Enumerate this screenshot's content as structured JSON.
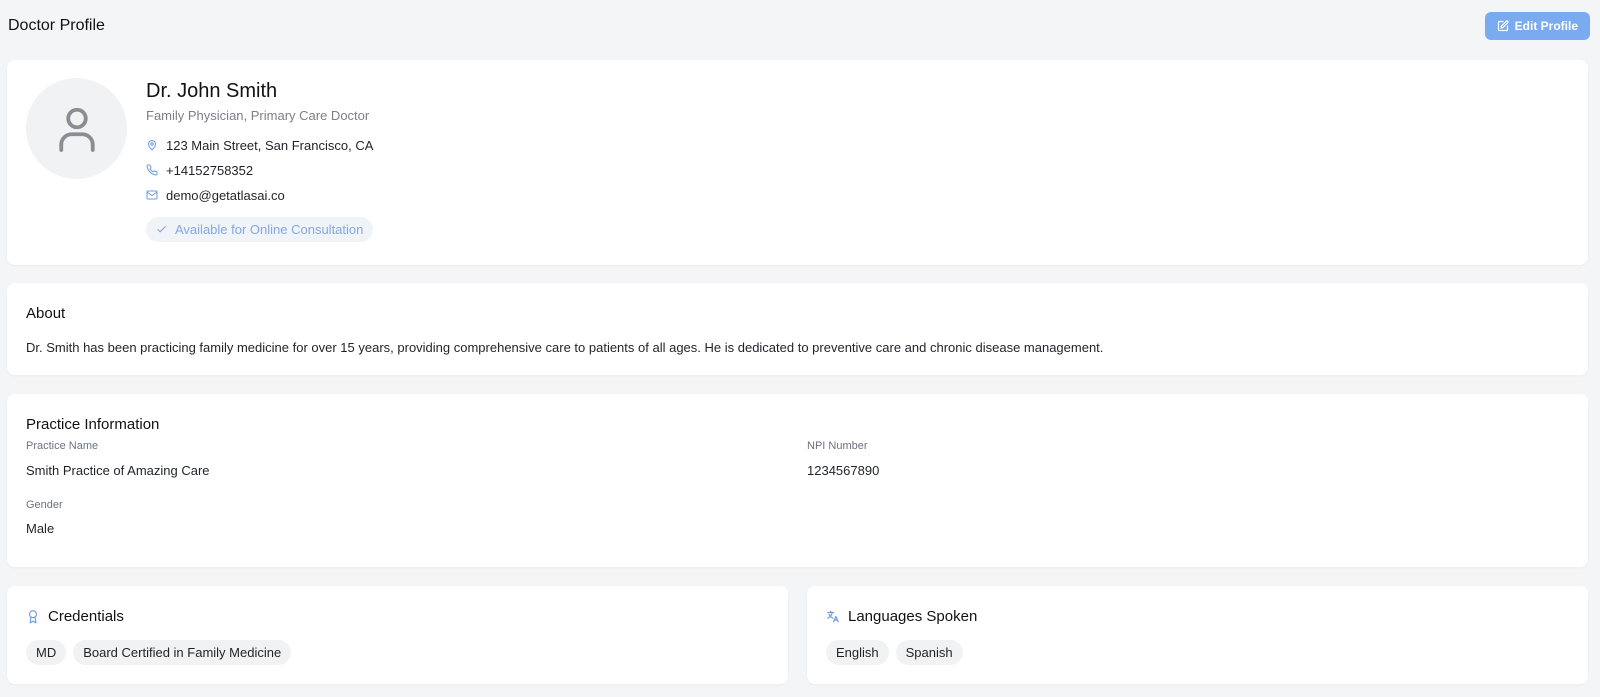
{
  "header": {
    "title": "Doctor Profile",
    "edit_label": "Edit Profile"
  },
  "profile": {
    "name": "Dr. John Smith",
    "specialty": "Family Physician, Primary Care Doctor",
    "address": "123 Main Street, San Francisco, CA",
    "phone": "+14152758352",
    "email": "demo@getatlasai.co",
    "availability": "Available for Online Consultation"
  },
  "about": {
    "title": "About",
    "text": "Dr. Smith has been practicing family medicine for over 15 years, providing comprehensive care to patients of all ages. He is dedicated to preventive care and chronic disease management."
  },
  "practice": {
    "title": "Practice Information",
    "practice_name_label": "Practice Name",
    "practice_name": "Smith Practice of Amazing Care",
    "npi_label": "NPI Number",
    "npi": "1234567890",
    "gender_label": "Gender",
    "gender": "Male"
  },
  "credentials": {
    "title": "Credentials",
    "items": [
      "MD",
      "Board Certified in Family Medicine"
    ]
  },
  "languages": {
    "title": "Languages Spoken",
    "items": [
      "English",
      "Spanish"
    ]
  },
  "colors": {
    "accent": "#7aaaf0",
    "badge_text": "#86a9de",
    "background": "#f4f5f7"
  },
  "icons": {
    "edit": "edit-icon",
    "avatar": "user-icon",
    "address": "map-pin-icon",
    "phone": "phone-icon",
    "email": "mail-icon",
    "availability": "check-icon",
    "credentials": "award-icon",
    "languages": "translate-icon"
  }
}
